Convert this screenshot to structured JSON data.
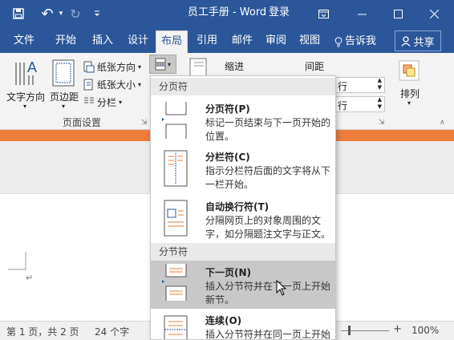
{
  "window": {
    "title": "员工手册 - Word",
    "login": "登录",
    "undo_glyph": "↶",
    "redo_glyph": "↻"
  },
  "tabs": [
    {
      "label": "文件"
    },
    {
      "label": "开始"
    },
    {
      "label": "插入"
    },
    {
      "label": "设计"
    },
    {
      "label": "布局"
    },
    {
      "label": "引用"
    },
    {
      "label": "邮件"
    },
    {
      "label": "审阅"
    },
    {
      "label": "视图"
    }
  ],
  "tell_me": "告诉我",
  "share": "共享",
  "ribbon": {
    "text_direction": "文字方向",
    "margins": "页边距",
    "orientation": "纸张方向",
    "size": "纸张大小",
    "columns": "分栏",
    "page_setup_label": "页面设置",
    "indent_label": "缩进",
    "spacing_label": "间距",
    "spin1_value": "行",
    "spin2_value": "行",
    "arrange": "排列"
  },
  "dropdown": {
    "section_page_breaks": "分页符",
    "section_section_breaks": "分节符",
    "items": [
      {
        "title": "分页符(P)",
        "desc": "标记一页结束与下一页开始的位置。"
      },
      {
        "title": "分栏符(C)",
        "desc": "指示分栏符后面的文字将从下一栏开始。"
      },
      {
        "title": "自动换行符(T)",
        "desc": "分隔网页上的对象周围的文字，如分隔题注文字与正文。"
      },
      {
        "title": "下一页(N)",
        "desc": "插入分节符并在下一页上开始新节。"
      },
      {
        "title": "连续(O)",
        "desc": "插入分节符并在同一页上开始"
      }
    ]
  },
  "status": {
    "pages": "第 1 页，共 2 页",
    "words": "24 个字",
    "zoom": "100%"
  },
  "colors": {
    "accent": "#2b579a",
    "orange": "#ee7d3a"
  }
}
